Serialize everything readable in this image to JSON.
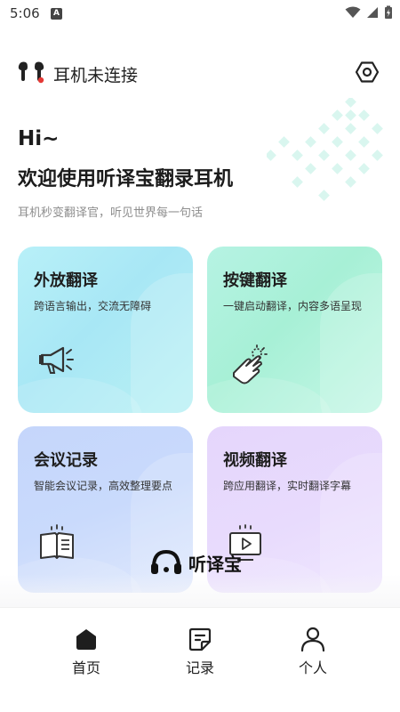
{
  "status_bar": {
    "time": "5:06",
    "notification_badge": "A",
    "icons": [
      "wifi-icon",
      "signal-icon",
      "battery-charging-icon"
    ]
  },
  "header": {
    "connection_status": "耳机未连接",
    "left_icon": "earbuds-icon",
    "right_icon": "settings-icon"
  },
  "greeting": {
    "hi": "Hi~",
    "welcome": "欢迎使用听译宝翻录耳机",
    "subtitle": "耳机秒变翻译官，听见世界每一句话"
  },
  "features": [
    {
      "title": "外放翻译",
      "desc": "跨语言输出，交流无障碍",
      "icon": "megaphone-icon",
      "color": "#aee9f6"
    },
    {
      "title": "按键翻译",
      "desc": "一键启动翻译，内容多语呈现",
      "icon": "tap-hand-icon",
      "color": "#abf1da"
    },
    {
      "title": "会议记录",
      "desc": "智能会议记录，高效整理要点",
      "icon": "open-book-icon",
      "color": "#c8d9fc"
    },
    {
      "title": "视频翻译",
      "desc": "跨应用翻译，实时翻译字幕",
      "icon": "video-screen-icon",
      "color": "#e6d9fd"
    }
  ],
  "brand": {
    "name": "听译宝",
    "icon": "headphones-logo-icon"
  },
  "bottom_nav": {
    "items": [
      {
        "label": "首页",
        "icon": "home-icon",
        "active": true
      },
      {
        "label": "记录",
        "icon": "document-icon",
        "active": false
      },
      {
        "label": "个人",
        "icon": "person-icon",
        "active": false
      }
    ]
  },
  "colors": {
    "accent_red": "#e53935",
    "text_primary": "#1b1b1b",
    "text_secondary": "#8e8e8e",
    "pattern_teal": "#d9f6ef"
  }
}
